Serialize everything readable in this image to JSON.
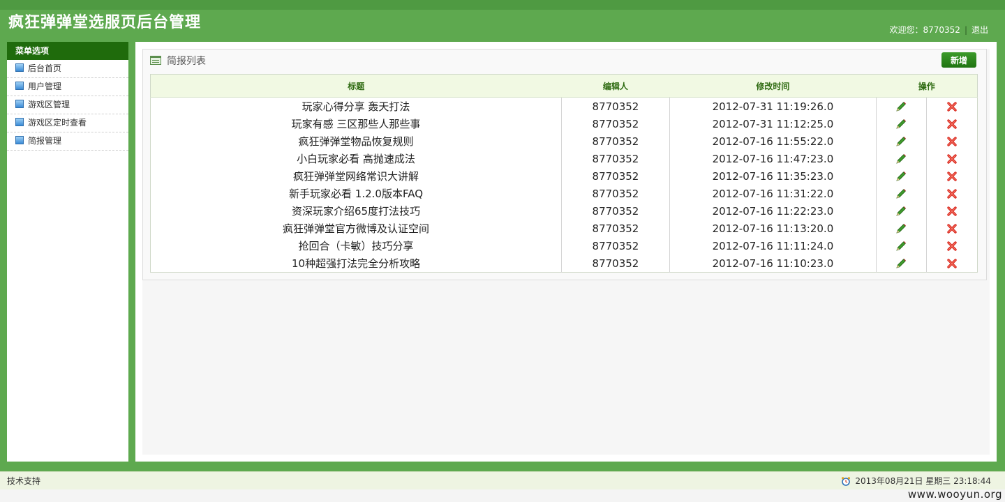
{
  "header": {
    "title": "疯狂弹弹堂选服页后台管理",
    "welcome": "欢迎您：8770352",
    "separator": "|",
    "logout": "退出"
  },
  "sidebar": {
    "heading": "菜单选项",
    "items": [
      {
        "label": "后台首页"
      },
      {
        "label": "用户管理"
      },
      {
        "label": "游戏区管理"
      },
      {
        "label": "游戏区定时查看"
      },
      {
        "label": "简报管理"
      }
    ]
  },
  "panel": {
    "title": "简报列表",
    "add_label": "新增"
  },
  "table": {
    "columns": [
      "标题",
      "编辑人",
      "修改时间",
      "操作"
    ],
    "rows": [
      {
        "title": "玩家心得分享  轰天打法",
        "editor": "8770352",
        "time": "2012-07-31 11:19:26.0"
      },
      {
        "title": "玩家有感  三区那些人那些事",
        "editor": "8770352",
        "time": "2012-07-31 11:12:25.0"
      },
      {
        "title": "疯狂弹弹堂物品恢复规则",
        "editor": "8770352",
        "time": "2012-07-16 11:55:22.0"
      },
      {
        "title": "小白玩家必看  高抛速成法",
        "editor": "8770352",
        "time": "2012-07-16 11:47:23.0"
      },
      {
        "title": "疯狂弹弹堂网络常识大讲解",
        "editor": "8770352",
        "time": "2012-07-16 11:35:23.0"
      },
      {
        "title": "新手玩家必看  1.2.0版本FAQ",
        "editor": "8770352",
        "time": "2012-07-16 11:31:22.0"
      },
      {
        "title": "资深玩家介绍65度打法技巧",
        "editor": "8770352",
        "time": "2012-07-16 11:22:23.0"
      },
      {
        "title": "疯狂弹弹堂官方微博及认证空间",
        "editor": "8770352",
        "time": "2012-07-16 11:13:20.0"
      },
      {
        "title": "抢回合（卡敏）技巧分享",
        "editor": "8770352",
        "time": "2012-07-16 11:11:24.0"
      },
      {
        "title": "10种超强打法完全分析攻略",
        "editor": "8770352",
        "time": "2012-07-16 11:10:23.0"
      }
    ]
  },
  "footer": {
    "support": "技术支持",
    "datetime": "2013年08月21日  星期三  23:18:44"
  },
  "watermark": "www.wooyun.org",
  "colors": {
    "brand_green": "#5ea94f",
    "sidebar_head": "#1f6b0c",
    "button_green": "#2a8a1b",
    "header_row": "#f1f9e3",
    "delete_red": "#d9261c"
  },
  "icons": {
    "edit": "pencil-icon",
    "delete": "delete-icon",
    "menu_item": "square-bullet-icon",
    "panel": "list-icon",
    "clock": "alarm-clock-icon"
  }
}
